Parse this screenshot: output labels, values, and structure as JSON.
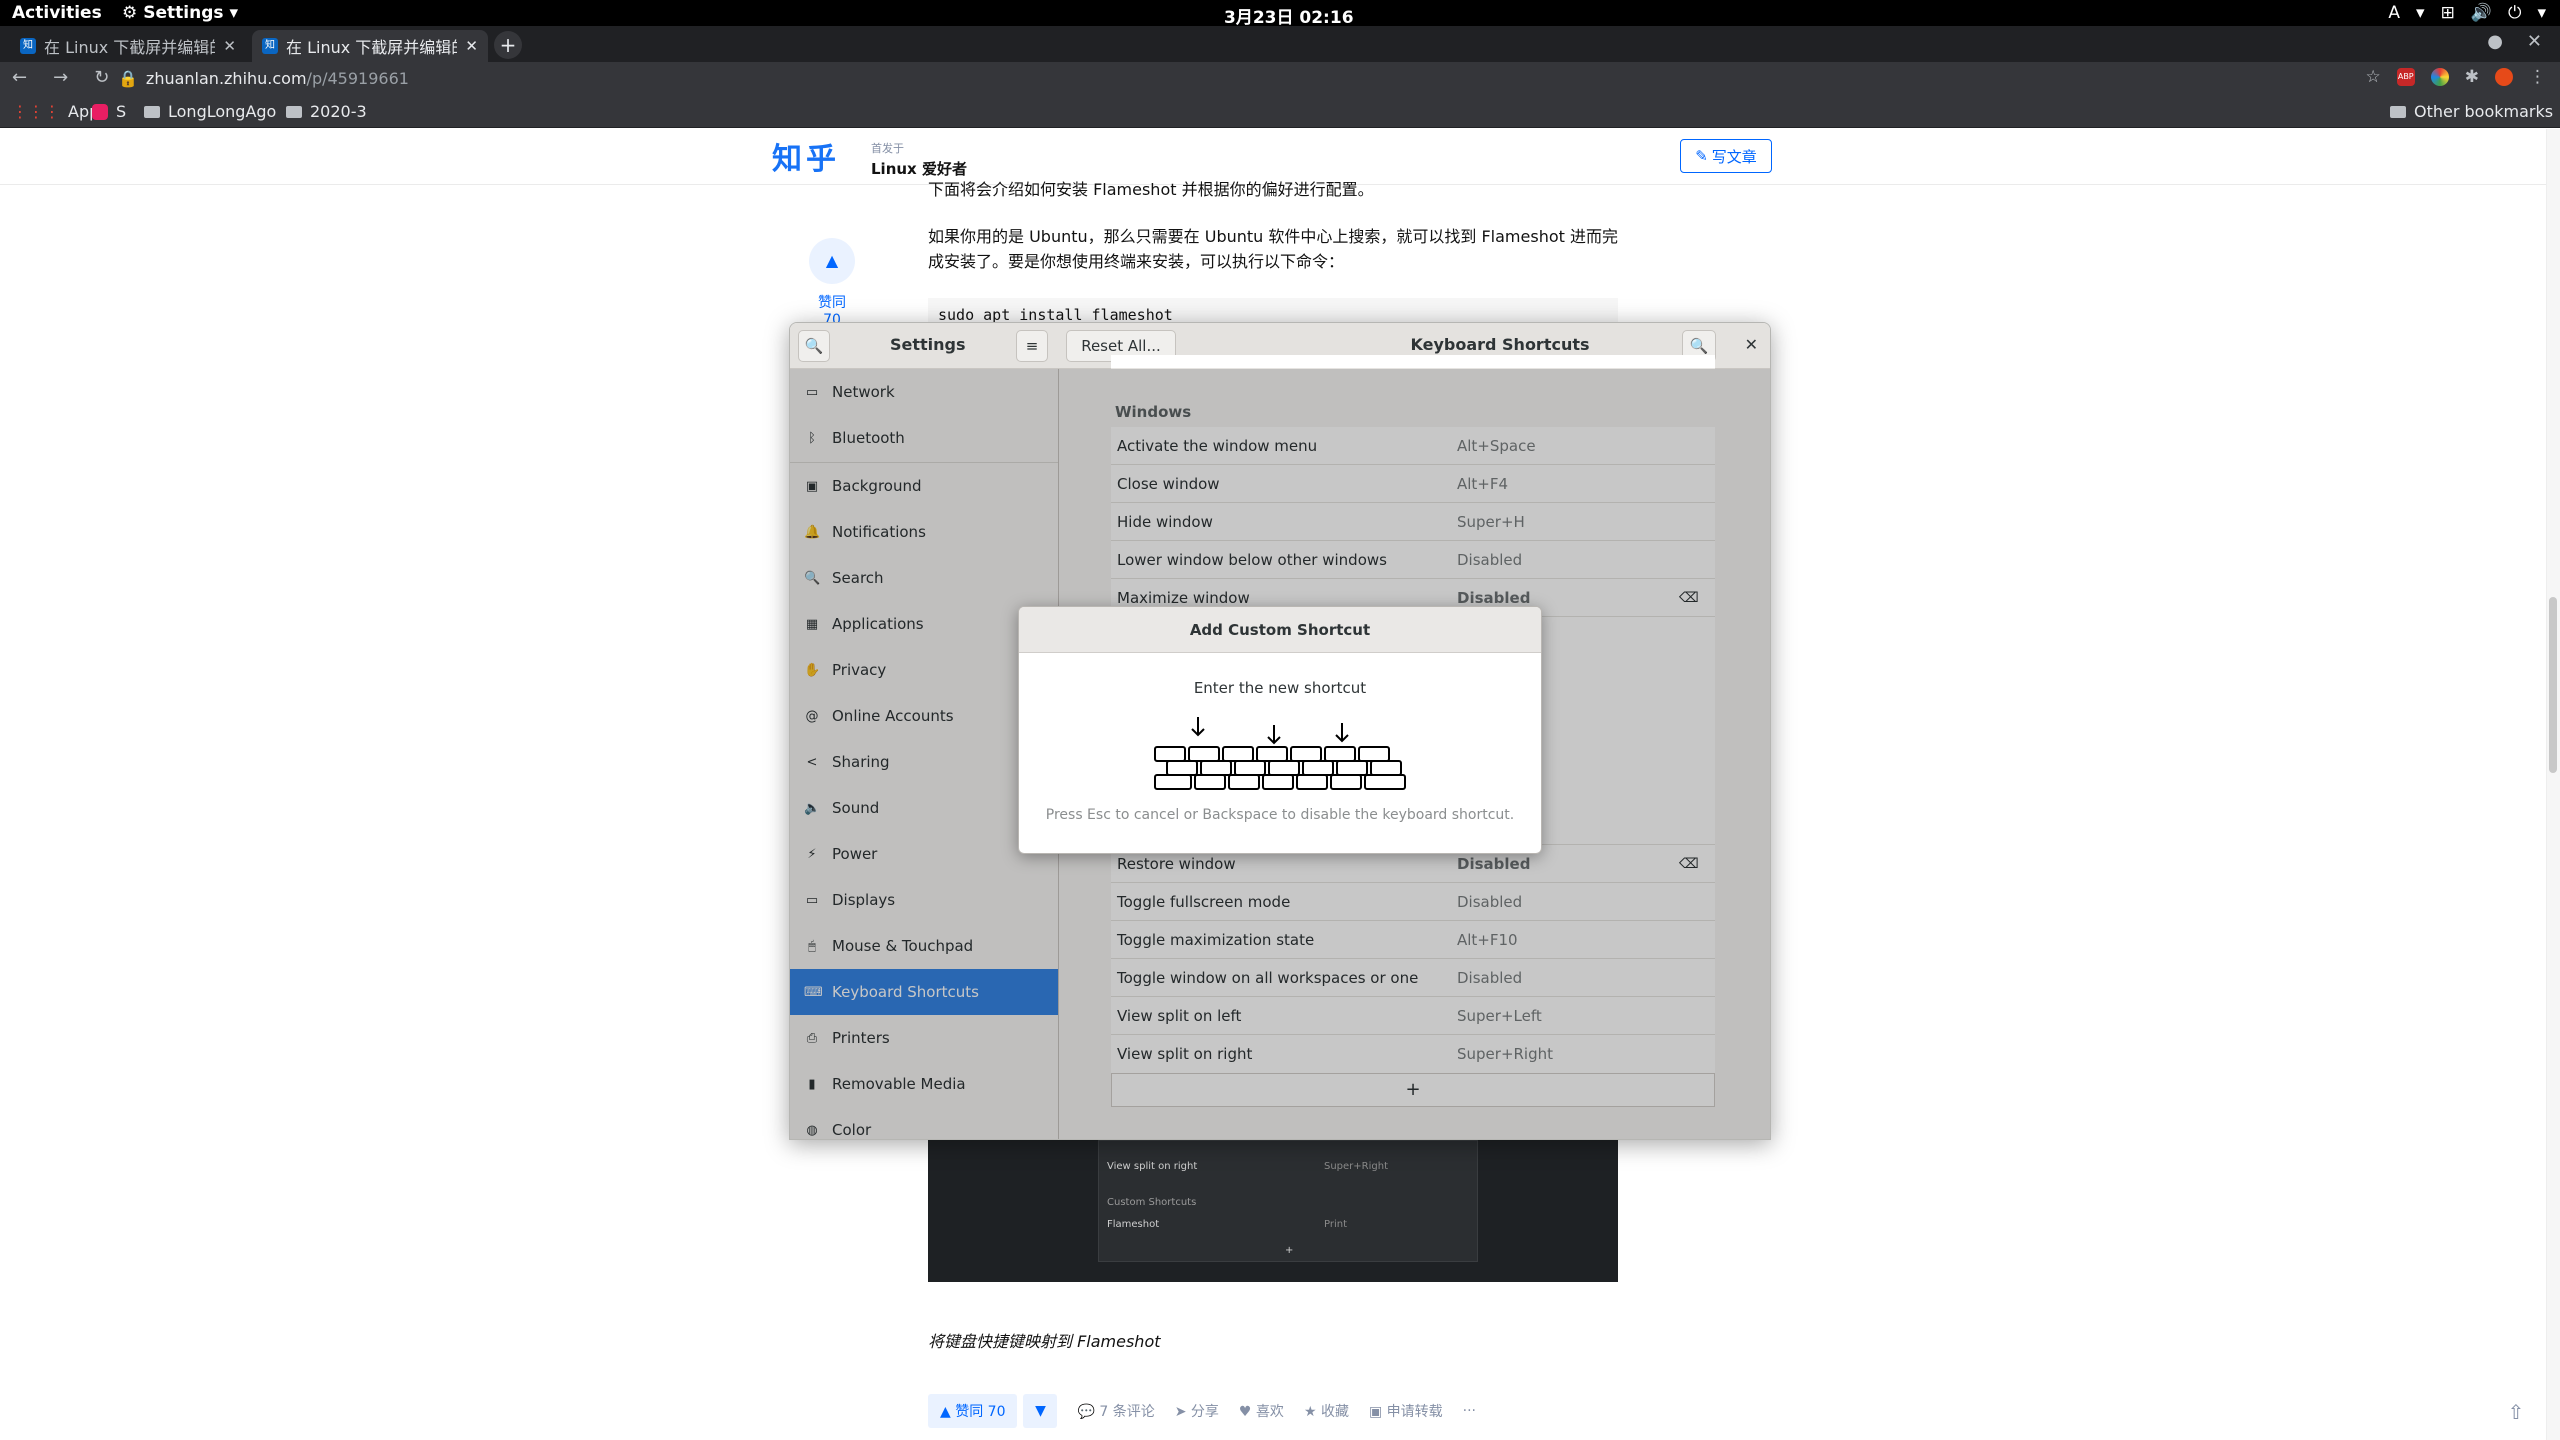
{
  "topbar": {
    "activities": "Activities",
    "app_menu": "Settings",
    "clock": "3月23日  02:16",
    "input_source": "A"
  },
  "browser": {
    "tabs": [
      {
        "title": "在 Linux 下截屏并编辑的",
        "favicon": "知"
      },
      {
        "title": "在 Linux 下截屏并编辑的",
        "favicon": "知"
      }
    ],
    "new_tab": "+",
    "url_host": "zhuanlan.zhihu.com",
    "url_path": "/p/45919661",
    "bookmarks": {
      "apps": "Apps",
      "s": "S",
      "folder1": "LongLongAgo",
      "folder2": "2020-3",
      "other": "Other bookmarks"
    },
    "extension_badge": "ABP"
  },
  "zhihu": {
    "logo": "知乎",
    "published_in": "首发于",
    "column": "Linux 爱好者",
    "write_button": "写文章",
    "paragraph1": "下面将会介绍如何安装 Flameshot 并根据你的偏好进行配置。",
    "paragraph2": "如果你用的是 Ubuntu，那么只需要在 Ubuntu 软件中心上搜索，就可以找到 Flameshot 进而完成安装了。要是你想使用终端来安装，可以执行以下命令：",
    "code": "sudo apt install flameshot",
    "side_vote": "赞同 70",
    "caption": "将键盘快捷键映射到 Flameshot",
    "embedded_image": {
      "rows": [
        {
          "name": "View split on right",
          "value": "Super+Right"
        }
      ],
      "section": "Custom Shortcuts",
      "custom": {
        "name": "Flameshot",
        "value": "Print"
      },
      "plus": "+"
    },
    "actions": {
      "vote": "▲ 赞同 70",
      "comments": "7 条评论",
      "share": "分享",
      "like": "喜欢",
      "collect": "收藏",
      "repost": "申请转载",
      "more": "···"
    }
  },
  "settings": {
    "title": "Settings",
    "panel_title": "Keyboard Shortcuts",
    "reset_button": "Reset All...",
    "sidebar": [
      {
        "label": "Network",
        "icon": "network-icon"
      },
      {
        "label": "Bluetooth",
        "icon": "bluetooth-icon"
      },
      {
        "label": "Background",
        "icon": "background-icon"
      },
      {
        "label": "Notifications",
        "icon": "bell-icon"
      },
      {
        "label": "Search",
        "icon": "search-icon"
      },
      {
        "label": "Applications",
        "icon": "grid-icon"
      },
      {
        "label": "Privacy",
        "icon": "hand-icon"
      },
      {
        "label": "Online Accounts",
        "icon": "at-icon"
      },
      {
        "label": "Sharing",
        "icon": "share-icon"
      },
      {
        "label": "Sound",
        "icon": "speaker-icon"
      },
      {
        "label": "Power",
        "icon": "power-icon"
      },
      {
        "label": "Displays",
        "icon": "display-icon"
      },
      {
        "label": "Mouse & Touchpad",
        "icon": "mouse-icon"
      },
      {
        "label": "Keyboard Shortcuts",
        "icon": "keyboard-icon",
        "active": true
      },
      {
        "label": "Printers",
        "icon": "printer-icon"
      },
      {
        "label": "Removable Media",
        "icon": "usb-icon"
      },
      {
        "label": "Color",
        "icon": "color-icon"
      }
    ],
    "section_title": "Windows",
    "rows": [
      {
        "name": "Activate the window menu",
        "accel": "Alt+Space"
      },
      {
        "name": "Close window",
        "accel": "Alt+F4"
      },
      {
        "name": "Hide window",
        "accel": "Super+H"
      },
      {
        "name": "Lower window below other windows",
        "accel": "Disabled"
      },
      {
        "name": "Maximize window",
        "accel": "Disabled"
      },
      {
        "name": "Restore window",
        "accel": "Disabled"
      },
      {
        "name": "Toggle fullscreen mode",
        "accel": "Disabled"
      },
      {
        "name": "Toggle maximization state",
        "accel": "Alt+F10"
      },
      {
        "name": "Toggle window on all workspaces or one",
        "accel": "Disabled"
      },
      {
        "name": "View split on left",
        "accel": "Super+Left"
      },
      {
        "name": "View split on right",
        "accel": "Super+Right"
      }
    ],
    "add_button": "+"
  },
  "dialog": {
    "title": "Add Custom Shortcut",
    "message": "Enter the new shortcut",
    "hint": "Press Esc to cancel or Backspace to disable the keyboard shortcut."
  },
  "colors": {
    "accent": "#3584e4",
    "zhihu_blue": "#0066ff"
  }
}
